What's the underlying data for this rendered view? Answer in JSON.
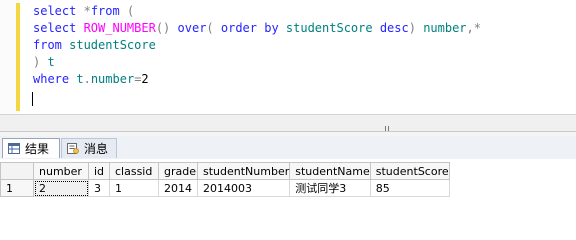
{
  "editor": {
    "lines": [
      [
        {
          "t": "select ",
          "c": "kw"
        },
        {
          "t": "*",
          "c": "op"
        },
        {
          "t": "from ",
          "c": "kw"
        },
        {
          "t": "(",
          "c": "op"
        }
      ],
      [
        {
          "t": "select ",
          "c": "kw"
        },
        {
          "t": "ROW_NUMBER",
          "c": "fn"
        },
        {
          "t": "() ",
          "c": "op"
        },
        {
          "t": "over",
          "c": "kw"
        },
        {
          "t": "( ",
          "c": "op"
        },
        {
          "t": "order by ",
          "c": "kw"
        },
        {
          "t": "studentScore ",
          "c": "id"
        },
        {
          "t": "desc",
          "c": "kw"
        },
        {
          "t": ") ",
          "c": "op"
        },
        {
          "t": "number",
          "c": "id"
        },
        {
          "t": ",*",
          "c": "op"
        }
      ],
      [
        {
          "t": "from ",
          "c": "kw"
        },
        {
          "t": "studentScore",
          "c": "id"
        }
      ],
      [
        {
          "t": ") ",
          "c": "op"
        },
        {
          "t": "t",
          "c": "id"
        }
      ],
      [
        {
          "t": "where ",
          "c": "kw"
        },
        {
          "t": "t",
          "c": "id"
        },
        {
          "t": ".",
          "c": "op"
        },
        {
          "t": "number",
          "c": "id"
        },
        {
          "t": "=",
          "c": "op"
        },
        {
          "t": "2",
          "c": "pl"
        }
      ]
    ]
  },
  "tabs": {
    "results_label": "结果",
    "messages_label": "消息"
  },
  "grid": {
    "columns": [
      "number",
      "id",
      "classid",
      "grade",
      "studentNumber",
      "studentName",
      "studentScore"
    ],
    "rows": [
      {
        "rownum": "1",
        "cells": [
          "2",
          "3",
          "1",
          "2014",
          "2014003",
          "测试同学3",
          "85"
        ]
      }
    ]
  }
}
